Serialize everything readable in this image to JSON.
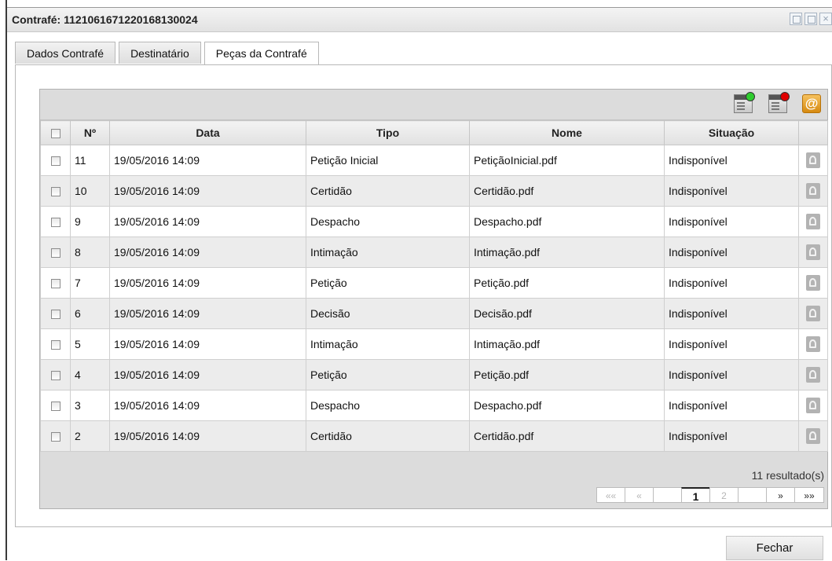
{
  "dialog": {
    "title": "Contrafé: 1121061671220168130024"
  },
  "tabs": [
    {
      "label": "Dados Contrafé",
      "active": false
    },
    {
      "label": "Destinatário",
      "active": false
    },
    {
      "label": "Peças da Contrafé",
      "active": true
    }
  ],
  "toolbar": {
    "icons": [
      "document-green-dot-icon",
      "document-red-dot-icon",
      "email-at-icon"
    ],
    "colors": {
      "green": "#2ecc2e",
      "red": "#e00000",
      "orange": "#e8a020"
    }
  },
  "table": {
    "headers": {
      "num": "Nº",
      "data": "Data",
      "tipo": "Tipo",
      "nome": "Nome",
      "situacao": "Situação"
    },
    "rows": [
      {
        "num": "11",
        "data": "19/05/2016 14:09",
        "tipo": "Petição Inicial",
        "nome": "PetiçãoInicial.pdf",
        "situacao": "Indisponível"
      },
      {
        "num": "10",
        "data": "19/05/2016 14:09",
        "tipo": "Certidão",
        "nome": "Certidão.pdf",
        "situacao": "Indisponível"
      },
      {
        "num": "9",
        "data": "19/05/2016 14:09",
        "tipo": "Despacho",
        "nome": "Despacho.pdf",
        "situacao": "Indisponível"
      },
      {
        "num": "8",
        "data": "19/05/2016 14:09",
        "tipo": "Intimação",
        "nome": "Intimação.pdf",
        "situacao": "Indisponível"
      },
      {
        "num": "7",
        "data": "19/05/2016 14:09",
        "tipo": "Petição",
        "nome": "Petição.pdf",
        "situacao": "Indisponível"
      },
      {
        "num": "6",
        "data": "19/05/2016 14:09",
        "tipo": "Decisão",
        "nome": "Decisão.pdf",
        "situacao": "Indisponível"
      },
      {
        "num": "5",
        "data": "19/05/2016 14:09",
        "tipo": "Intimação",
        "nome": "Intimação.pdf",
        "situacao": "Indisponível"
      },
      {
        "num": "4",
        "data": "19/05/2016 14:09",
        "tipo": "Petição",
        "nome": "Petição.pdf",
        "situacao": "Indisponível"
      },
      {
        "num": "3",
        "data": "19/05/2016 14:09",
        "tipo": "Despacho",
        "nome": "Despacho.pdf",
        "situacao": "Indisponível"
      },
      {
        "num": "2",
        "data": "19/05/2016 14:09",
        "tipo": "Certidão",
        "nome": "Certidão.pdf",
        "situacao": "Indisponível"
      }
    ]
  },
  "pagination": {
    "result_count": "11 resultado(s)",
    "first": "««",
    "prev": "«",
    "pages": [
      "1",
      "2"
    ],
    "current_page": "1",
    "next": "»",
    "last": "»»"
  },
  "actions": {
    "close_label": "Fechar"
  }
}
